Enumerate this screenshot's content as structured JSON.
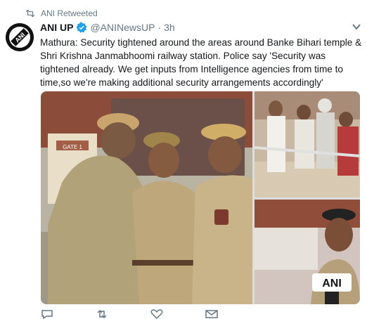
{
  "retweet": {
    "label": "ANI Retweeted",
    "icon": "retweet-icon"
  },
  "tweet": {
    "author_name": "ANI UP",
    "handle": "@ANINewsUP",
    "separator": "·",
    "time": "3h",
    "verified_icon": "verified-badge-icon",
    "text": "Mathura: Security tightened around the areas around Banke Bihari temple & Shri Krishna Janmabhoomi railway station. Police say 'Security was tightened already. We get inputs from Intelligence agencies from time to time,so we're making additional security arrangements accordingly'"
  },
  "avatar": {
    "logo_text": "ANI"
  },
  "media": {
    "photo_main": {
      "gate_sign": "GATE 1"
    },
    "photo_br": {
      "watermark": "ANI"
    }
  },
  "colors": {
    "verified": "#1da1f2",
    "muted": "#657786",
    "text": "#14171a"
  }
}
